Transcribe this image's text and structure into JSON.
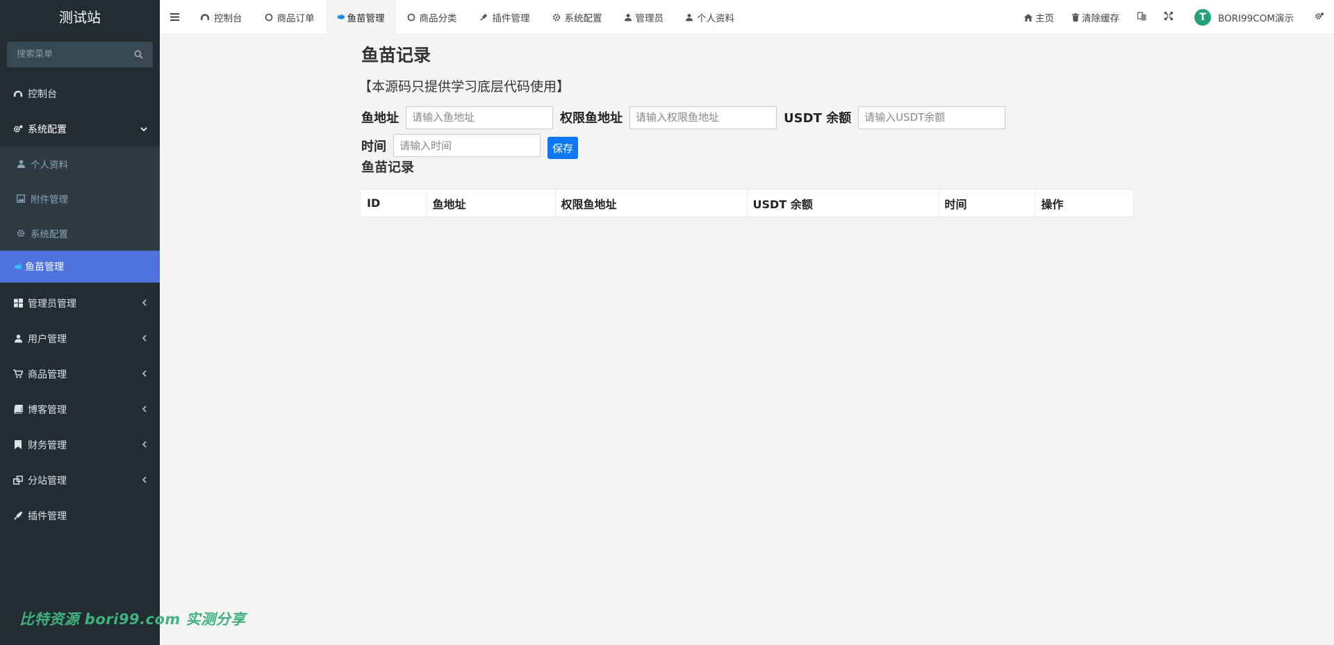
{
  "sidebar": {
    "brand": "测试站",
    "search_placeholder": "搜索菜单",
    "items": [
      {
        "label": "控制台",
        "icon": "dashboard-icon"
      },
      {
        "label": "系统配置",
        "icon": "cogs-icon"
      },
      {
        "label": "管理员管理",
        "icon": "windows-icon"
      },
      {
        "label": "用户管理",
        "icon": "user-icon"
      },
      {
        "label": "商品管理",
        "icon": "cart-icon"
      },
      {
        "label": "博客管理",
        "icon": "book-icon"
      },
      {
        "label": "财务管理",
        "icon": "bookmark-icon"
      },
      {
        "label": "分站管理",
        "icon": "clone-icon"
      },
      {
        "label": "插件管理",
        "icon": "plug-icon"
      }
    ],
    "submenu": [
      {
        "label": "个人资料",
        "icon": "user-icon"
      },
      {
        "label": "附件管理",
        "icon": "image-icon"
      },
      {
        "label": "系统配置",
        "icon": "gear-icon"
      },
      {
        "label": "鱼苗管理",
        "icon": "fish-icon"
      }
    ],
    "watermark": "比特资源 bori99.com 实测分享"
  },
  "navbar": {
    "tabs": [
      {
        "label": "控制台",
        "icon": "dashboard-icon"
      },
      {
        "label": "商品订单",
        "icon": "circle-icon"
      },
      {
        "label": "鱼苗管理",
        "icon": "fish-icon"
      },
      {
        "label": "商品分类",
        "icon": "circle-icon"
      },
      {
        "label": "插件管理",
        "icon": "plug-icon"
      },
      {
        "label": "系统配置",
        "icon": "gear-icon"
      },
      {
        "label": "管理员",
        "icon": "user-icon"
      },
      {
        "label": "个人资料",
        "icon": "user-icon"
      }
    ],
    "home_label": "主页",
    "clear_cache_label": "清除缓存",
    "avatar_letter": "T",
    "user_name": "BORI99COM演示"
  },
  "main": {
    "title": "鱼苗记录",
    "notice": "【本源码只提供学习底层代码使用】",
    "form": {
      "fish_address_label": "鱼地址",
      "fish_address_placeholder": "请输入鱼地址",
      "auth_address_label": "权限鱼地址",
      "auth_address_placeholder": "请输入权限鱼地址",
      "usdt_label": "USDT 余额",
      "usdt_placeholder": "请输入USDT余额",
      "time_label": "时间",
      "time_placeholder": "请输入时间",
      "save_label": "保存"
    },
    "records_title": "鱼苗记录",
    "table": {
      "columns": [
        "ID",
        "鱼地址",
        "权限鱼地址",
        "USDT 余额",
        "时间",
        "操作"
      ],
      "rows": []
    }
  },
  "colors": {
    "sidebar_bg": "#222d32",
    "active_menu": "#4e73df",
    "save_button": "#0d77f5",
    "avatar": "#26a17b",
    "watermark": "#3fb27f"
  }
}
